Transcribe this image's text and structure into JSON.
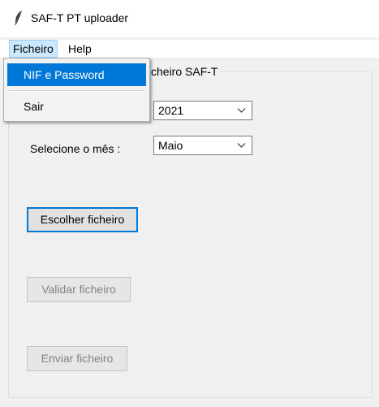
{
  "window": {
    "title": "SAF-T PT uploader",
    "icon": "feather-icon"
  },
  "menubar": {
    "items": [
      {
        "label": "Ficheiro"
      },
      {
        "label": "Help"
      }
    ]
  },
  "dropdown": {
    "items": [
      {
        "label": "NIF e Password"
      },
      {
        "label": "Sair"
      }
    ]
  },
  "group": {
    "title": "cheiro SAF-T"
  },
  "form": {
    "year_value": "2021",
    "month_label": "Selecione o mês :",
    "month_value": "Maio"
  },
  "buttons": {
    "choose": "Escolher ficheiro",
    "validate": "Validar ficheiro",
    "send": "Enviar ficheiro"
  },
  "colors": {
    "highlight": "#0078d7",
    "menu_active": "#cce8ff",
    "background": "#f0f0f0"
  }
}
